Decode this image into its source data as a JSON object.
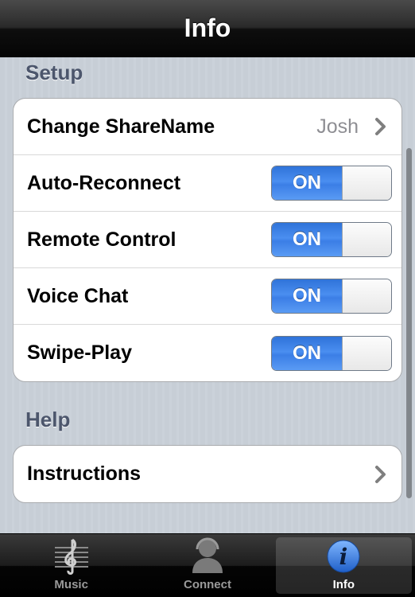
{
  "navbar": {
    "title": "Info"
  },
  "sections": {
    "setup": {
      "header": "Setup",
      "change_sharename": {
        "label": "Change ShareName",
        "value": "Josh"
      },
      "auto_reconnect": {
        "label": "Auto-Reconnect",
        "state": "ON"
      },
      "remote_control": {
        "label": "Remote Control",
        "state": "ON"
      },
      "voice_chat": {
        "label": "Voice Chat",
        "state": "ON"
      },
      "swipe_play": {
        "label": "Swipe-Play",
        "state": "ON"
      }
    },
    "help": {
      "header": "Help",
      "instructions": {
        "label": "Instructions"
      }
    }
  },
  "tabbar": {
    "tabs": [
      {
        "label": "Music",
        "icon": "music-note-icon",
        "active": false
      },
      {
        "label": "Connect",
        "icon": "people-icon",
        "active": false
      },
      {
        "label": "Info",
        "icon": "info-icon",
        "active": true
      }
    ]
  },
  "colors": {
    "toggle_on": "#3b7ee6",
    "section_header": "#4c566c",
    "active_info_icon": "#2a6fd6"
  }
}
